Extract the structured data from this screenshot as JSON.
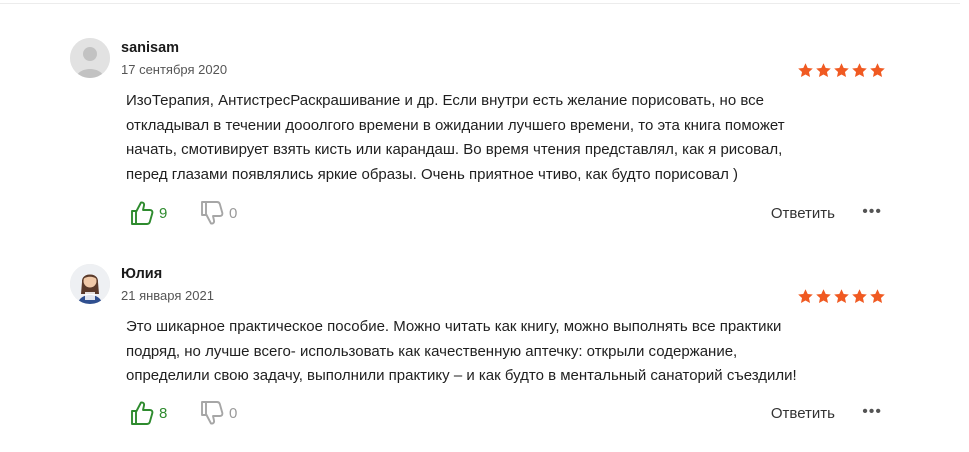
{
  "reviews": [
    {
      "author": "sanisam",
      "date": "17 сентября 2020",
      "rating": 5,
      "text_lines": [
        "ИзоТерапия, АнтистресРаскрашивание и др. Если внутри есть желание порисовать, но все",
        "откладывал в течении дооолгого времени в ожидании лучшего времени, то эта книга поможет",
        "начать, смотивирует взять кисть или карандаш. Во время чтения представлял, как я рисовал,",
        "перед глазами появлялись яркие образы. Очень приятное чтиво, как будто порисовал )"
      ],
      "likes": "9",
      "dislikes": "0",
      "reply_label": "Ответить",
      "more_label": "•••",
      "avatar_icon": "default-user-avatar-icon"
    },
    {
      "author": "Юлия",
      "date": "21 января 2021",
      "rating": 5,
      "text_lines": [
        "Это шикарное практическое пособие. Можно читать как книгу, можно выполнять все практики",
        "подряд, но лучше всего- использовать как качественную аптечку: открыли содержание,",
        "определили свою задачу, выполнили практику – и как будто в ментальный санаторий съездили!"
      ],
      "likes": "8",
      "dislikes": "0",
      "reply_label": "Ответить",
      "more_label": "•••",
      "avatar_icon": "user-photo-avatar-icon"
    }
  ],
  "colors": {
    "star": "#f05a22",
    "like": "#2e8b2e",
    "dislike": "#9a9a9a",
    "text": "#1f1f1f",
    "date": "#555555"
  }
}
